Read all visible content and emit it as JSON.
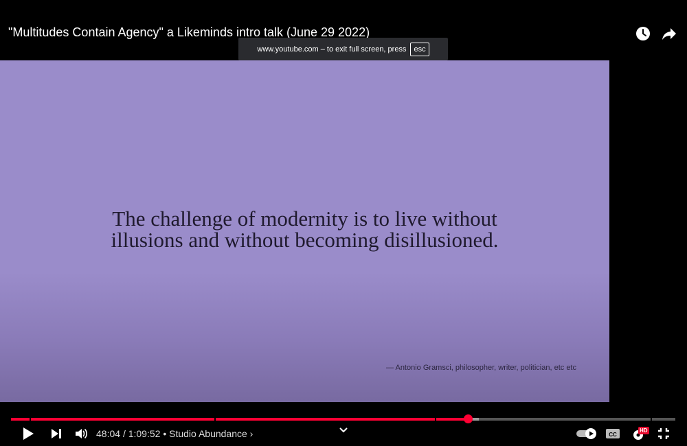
{
  "video": {
    "title": "\"Multitudes Contain Agency\" a Likeminds intro talk (June 29 2022)"
  },
  "toast": {
    "message": "www.youtube.com – to exit full screen, press",
    "key": "esc"
  },
  "slide": {
    "quote_line1": "The challenge of modernity is to live without",
    "quote_line2": "illusions and without becoming disillusioned.",
    "attribution": "— Antonio Gramsci, philosopher, writer, politician, etc etc"
  },
  "player": {
    "current_time": "48:04",
    "separator": "/",
    "duration": "1:09:52",
    "channel_sep": "•",
    "channel": "Studio Abundance",
    "channel_chevron": "›",
    "progress_fraction": 0.688,
    "hd_badge": "HD",
    "autoplay_on": true
  },
  "colors": {
    "played": "#ff0033",
    "buffered": "#9b9b9b",
    "unplayed": "#555555",
    "slide_bg": "#9a8cca"
  },
  "icons": [
    "watch-later-icon",
    "share-icon",
    "play-icon",
    "next-icon",
    "volume-icon",
    "chevron-down-icon",
    "autoplay-toggle-icon",
    "captions-icon",
    "settings-icon",
    "exit-fullscreen-icon"
  ]
}
